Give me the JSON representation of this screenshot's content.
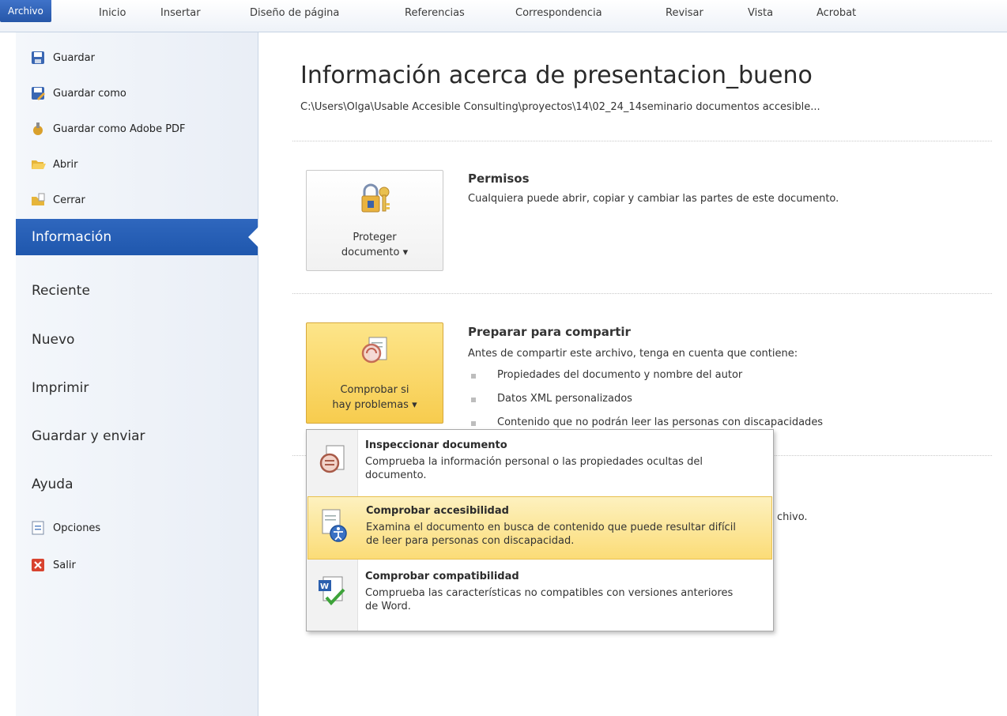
{
  "ribbon": {
    "tabs": [
      "Archivo",
      "Inicio",
      "Insertar",
      "Diseño de página",
      "Referencias",
      "Correspondencia",
      "Revisar",
      "Vista",
      "Acrobat"
    ],
    "active": "Archivo"
  },
  "leftnav": {
    "commands": [
      "Guardar",
      "Guardar como",
      "Guardar como Adobe PDF",
      "Abrir",
      "Cerrar"
    ],
    "sections": [
      "Información",
      "Reciente",
      "Nuevo",
      "Imprimir",
      "Guardar y enviar",
      "Ayuda"
    ],
    "bottom_commands": [
      "Opciones",
      "Salir"
    ],
    "active_section": "Información"
  },
  "info": {
    "title": "Información acerca de presentacion_bueno",
    "path": "C:\\Users\\Olga\\Usable Accesible Consulting\\proyectos\\14\\02_24_14seminario documentos accesible..."
  },
  "permissions": {
    "button_line1": "Proteger",
    "button_line2": "documento ▾",
    "title": "Permisos",
    "text": "Cualquiera puede abrir, copiar y cambiar las partes de este documento."
  },
  "prepare": {
    "button_line1": "Comprobar si",
    "button_line2": "hay problemas ▾",
    "title": "Preparar para compartir",
    "text": "Antes de compartir este archivo, tenga en cuenta que contiene:",
    "bullets": [
      "Propiedades del documento y nombre del autor",
      "Datos XML personalizados",
      "Contenido que no podrán leer las personas con discapacidades"
    ],
    "hidden_fragment": "chivo."
  },
  "menu": {
    "items": [
      {
        "title": "Inspeccionar documento",
        "desc": "Comprueba la información personal o las propiedades ocultas del documento."
      },
      {
        "title": "Comprobar accesibilidad",
        "desc": "Examina el documento en busca de contenido que puede resultar difícil de leer para personas con discapacidad."
      },
      {
        "title": "Comprobar compatibilidad",
        "desc": "Comprueba las características no compatibles con versiones anteriores de Word."
      }
    ]
  },
  "colors": {
    "accent": "#2a5fb4",
    "highlight": "#fbdc77"
  }
}
